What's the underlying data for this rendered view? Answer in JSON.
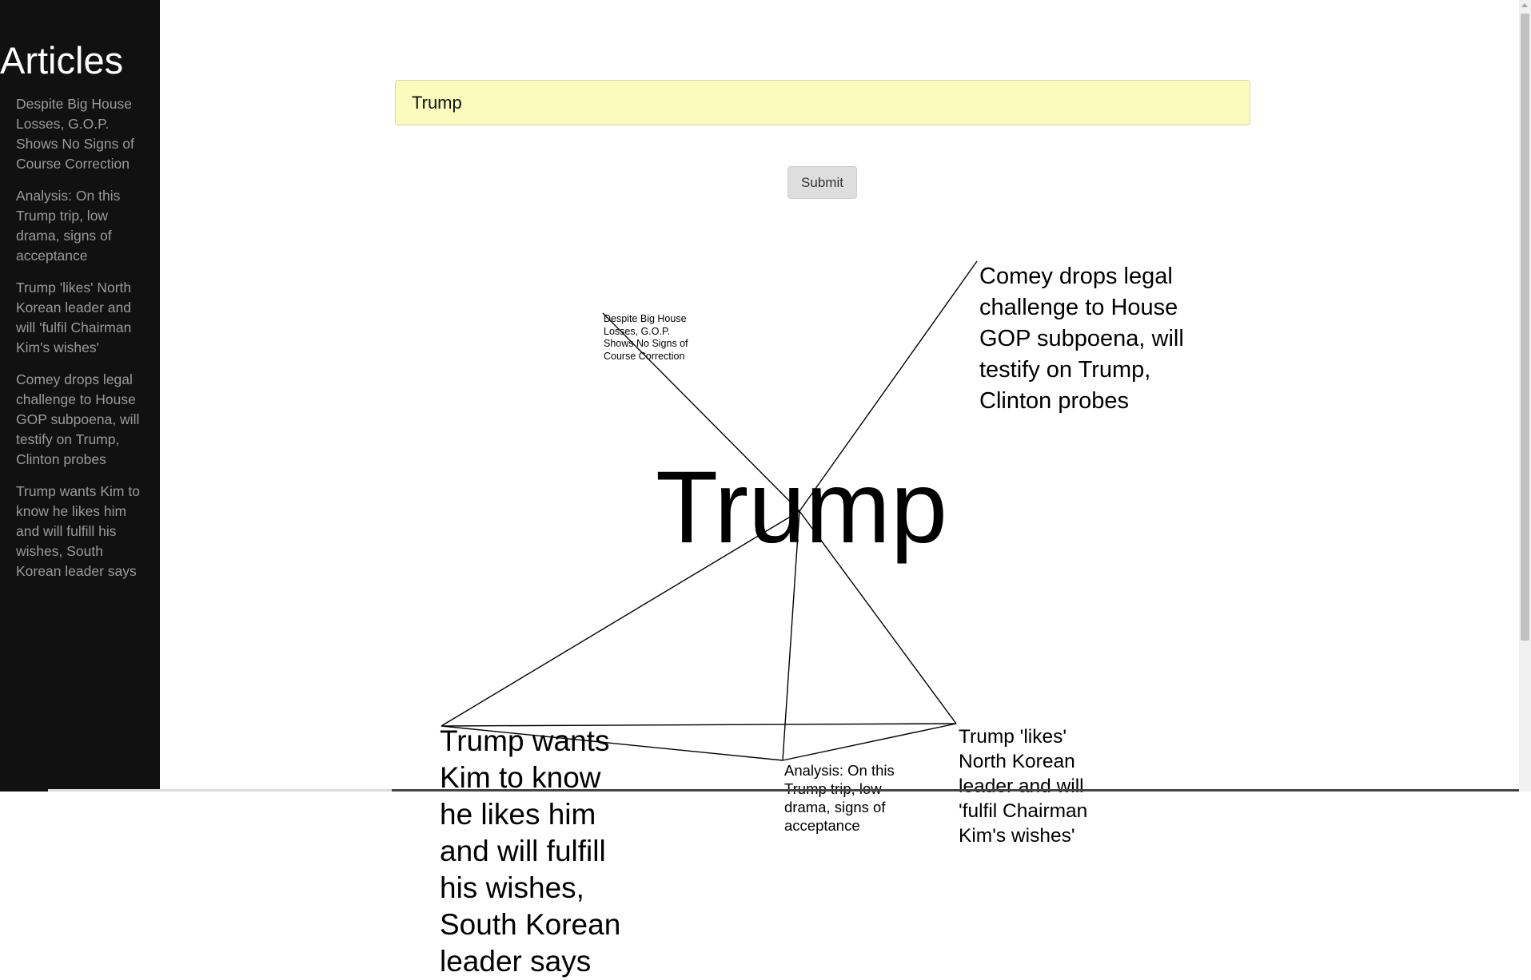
{
  "sidebar": {
    "title": "Articles",
    "articles": [
      "Despite Big House Losses, G.O.P. Shows No Signs of Course Correction",
      "Analysis: On this Trump trip, low drama, signs of acceptance",
      "Trump 'likes' North Korean leader and will 'fulfil Chairman Kim's wishes'",
      "Comey drops legal challenge to House GOP subpoena, will testify on Trump, Clinton probes",
      "Trump wants Kim to know he likes him and will fulfill his wishes, South Korean leader says"
    ]
  },
  "search": {
    "value": "Trump"
  },
  "submit_label": "Submit",
  "graph": {
    "center": "Trump",
    "nodes": [
      "Despite Big House Losses, G.O.P. Shows No Signs of Course Correction",
      "Analysis: On this Trump trip, low drama, signs of acceptance",
      "Trump 'likes' North Korean leader and will 'fulfil Chairman Kim's wishes'",
      "Comey drops legal challenge to House GOP subpoena, will testify on Trump, Clinton probes",
      "Trump wants Kim to know he likes him and will fulfill his wishes, South Korean leader says"
    ]
  }
}
